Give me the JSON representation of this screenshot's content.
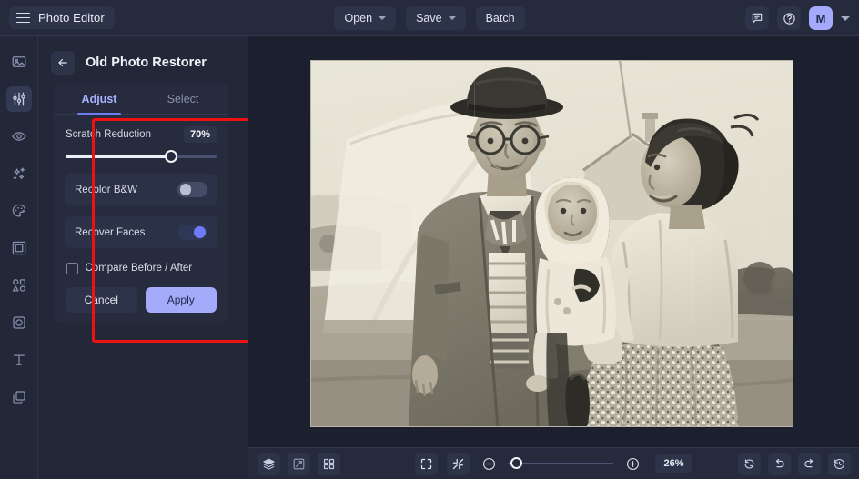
{
  "app": {
    "brand_title": "Photo Editor",
    "menu_icon": "hamburger-icon"
  },
  "topbar": {
    "open_label": "Open",
    "save_label": "Save",
    "batch_label": "Batch",
    "feedback_icon": "comment-icon",
    "help_icon": "help-circle-icon",
    "avatar_initial": "M"
  },
  "rail": {
    "items": [
      {
        "icon": "image-icon",
        "name": "image",
        "active": false
      },
      {
        "icon": "sliders-icon",
        "name": "adjust",
        "active": true
      },
      {
        "icon": "eye-icon",
        "name": "retouch",
        "active": false
      },
      {
        "icon": "sparkles-icon",
        "name": "effects",
        "active": false
      },
      {
        "icon": "palette-icon",
        "name": "color",
        "active": false
      },
      {
        "icon": "frame-icon",
        "name": "frame",
        "active": false
      },
      {
        "icon": "shapes-icon",
        "name": "shapes",
        "active": false
      },
      {
        "icon": "crop-icon",
        "name": "crop",
        "active": false
      },
      {
        "icon": "text-icon",
        "name": "text",
        "active": false
      },
      {
        "icon": "layers-icon",
        "name": "layers",
        "active": false
      }
    ]
  },
  "panel": {
    "back_icon": "arrow-left-icon",
    "title": "Old Photo Restorer",
    "tabs": [
      {
        "label": "Adjust",
        "active": true
      },
      {
        "label": "Select",
        "active": false
      }
    ],
    "slider": {
      "label": "Scratch Reduction",
      "value_text": "70%",
      "value": 70
    },
    "toggles": [
      {
        "label": "Recolor B&W",
        "on": false
      },
      {
        "label": "Recover Faces",
        "on": true
      }
    ],
    "checkbox": {
      "label": "Compare Before / After",
      "checked": false
    },
    "cancel_label": "Cancel",
    "apply_label": "Apply",
    "highlight_color": "#ee1111"
  },
  "bottombar": {
    "left_icons": [
      {
        "icon": "layers-stack-icon",
        "name": "layers-panel"
      },
      {
        "icon": "compare-icon",
        "name": "compare-view"
      },
      {
        "icon": "grid-icon",
        "name": "grid-view"
      }
    ],
    "fit_icon": "fit-screen-icon",
    "collapse_icon": "collapse-icon",
    "zoom_out_icon": "zoom-out-icon",
    "zoom_in_icon": "zoom-in-icon",
    "zoom_value": "26%",
    "zoom_percent": 26,
    "right_icons": [
      {
        "icon": "reset-icon",
        "name": "reset"
      },
      {
        "icon": "undo-icon",
        "name": "undo"
      },
      {
        "icon": "redo-icon",
        "name": "redo"
      },
      {
        "icon": "history-icon",
        "name": "history"
      }
    ]
  },
  "canvas": {
    "image_alt": "Vintage black and white photograph of a man in a bowler hat and glasses standing beside a woman holding a baby outdoors",
    "background": "#1b1f2e"
  },
  "colors": {
    "accent": "#6d7bf5",
    "accent_light": "#a5abfb",
    "panel_bg": "#232838",
    "card_bg": "#262b3d",
    "topbar_bg": "#252a3c"
  }
}
